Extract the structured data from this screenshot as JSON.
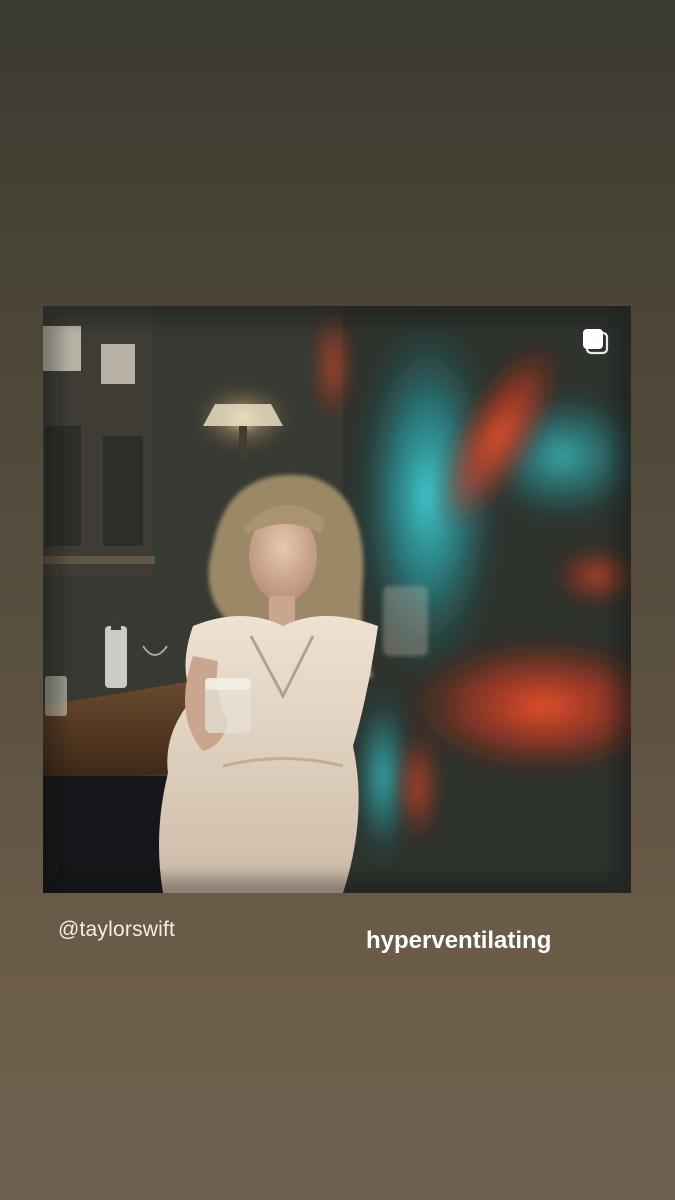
{
  "story": {
    "mention": "@taylorswift",
    "caption": "hyperventilating"
  },
  "post": {
    "icons": [
      "multiple-photos-icon"
    ],
    "photo_description_colors": {
      "teal_light": "#29d1d6",
      "red_light": "#ff3a18",
      "dress": "#e6d8c8"
    }
  }
}
